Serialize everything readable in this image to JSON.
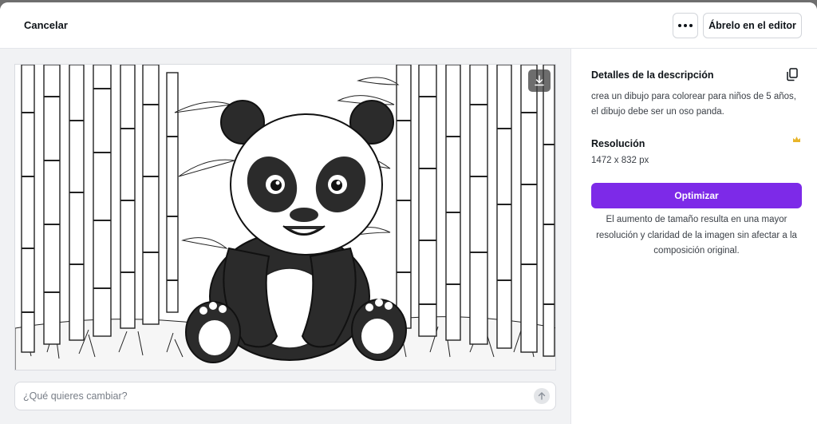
{
  "toolbar": {
    "cancel_label": "Cancelar",
    "more_icon": "more-horizontal-icon",
    "open_editor_label": "Ábrelo en el editor"
  },
  "preview": {
    "image_description_icon": "panda-illustration",
    "download_icon": "download-icon"
  },
  "prompt": {
    "placeholder": "¿Qué quieres cambiar?",
    "value": "",
    "send_icon": "arrow-up-icon"
  },
  "details": {
    "title": "Detalles de la descripción",
    "copy_icon": "copy-icon",
    "description_line1": "crea un dibujo para colorear para niños de 5 años,",
    "description_line2": "el dibujo debe ser un oso panda.",
    "resolution_title": "Resolución",
    "resolution_value": "1472 x 832 px",
    "crown_icon": "crown-icon",
    "optimize_label": "Optimizar",
    "note_line1": "El aumento de tamaño resulta en una mayor",
    "note_line2": "resolución y claridad de la imagen sin afectar a la",
    "note_line3": "composición original."
  },
  "colors": {
    "accent": "#7d2ae8",
    "crown": "#e8b52a",
    "text": "#0e1318"
  }
}
